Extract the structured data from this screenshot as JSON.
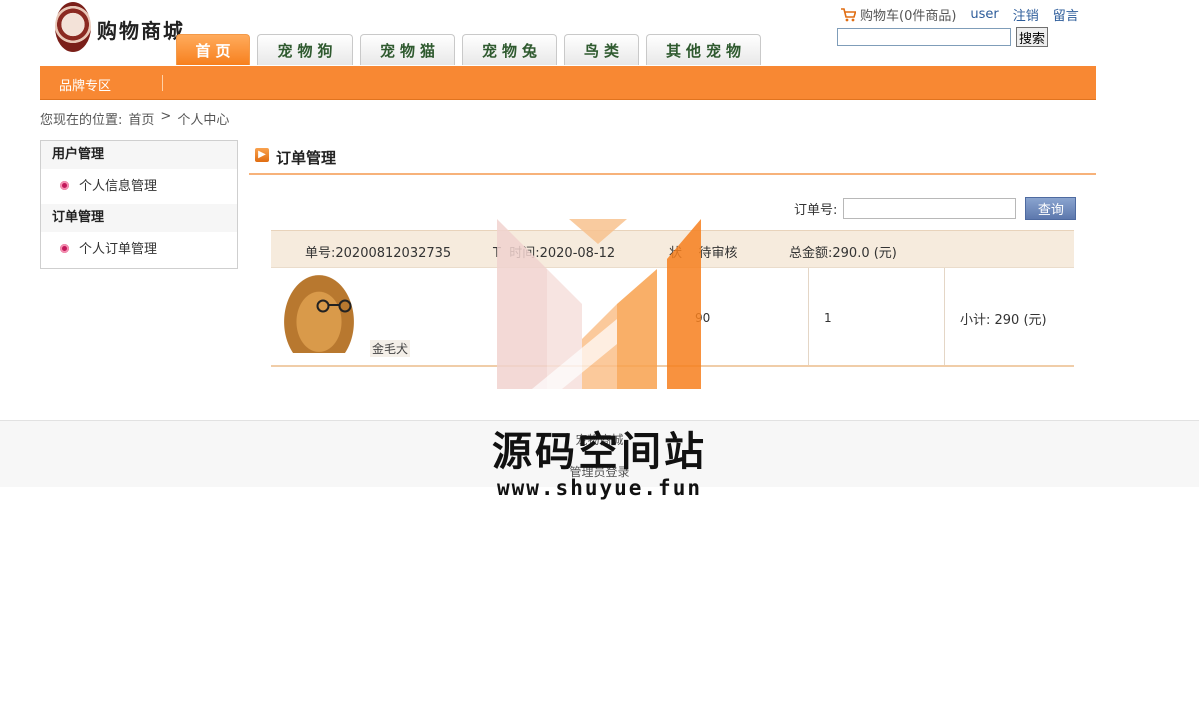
{
  "logo": {
    "text": "购物商城"
  },
  "toplinks": {
    "cart": "购物车(0件商品)",
    "user": "user",
    "logout": "注销",
    "message": "留言"
  },
  "search": {
    "placeholder": "",
    "button": "搜索"
  },
  "nav": {
    "tabs": [
      "首页",
      "宠物狗",
      "宠物猫",
      "宠物兔",
      "鸟类",
      "其他宠物"
    ],
    "active": 0
  },
  "brandbar": {
    "label": "品牌专区"
  },
  "breadcrumb": {
    "prefix": "您现在的位置:",
    "home": "首页",
    "sep": ">",
    "current": "个人中心"
  },
  "sidebar": {
    "groups": [
      {
        "title": "用户管理",
        "items": [
          "个人信息管理"
        ]
      },
      {
        "title": "订单管理",
        "items": [
          "个人订单管理"
        ]
      }
    ]
  },
  "content": {
    "title": "订单管理"
  },
  "order_search": {
    "label": "订单号:",
    "button": "查询"
  },
  "order": {
    "number_label": "单号:",
    "number": "20200812032735",
    "time_label_partial": "T",
    "time_label_rest": "时间:",
    "time": "2020-08-12",
    "status_label_partial": "状",
    "status": "待审核",
    "total_label": "总金额:",
    "total": "290.0 (元)",
    "item": {
      "name": "金毛犬",
      "price": "90",
      "qty": "1",
      "subtotal": "小计: 290 (元)"
    }
  },
  "footer": {
    "line1": "宠物商城",
    "admin": "管理员登录"
  },
  "watermark": {
    "title": "源码空间站",
    "url": "www.shuyue.fun"
  },
  "colors": {
    "accent": "#f88833",
    "tab_text": "#2f5a2f",
    "link": "#2d5c9a"
  }
}
